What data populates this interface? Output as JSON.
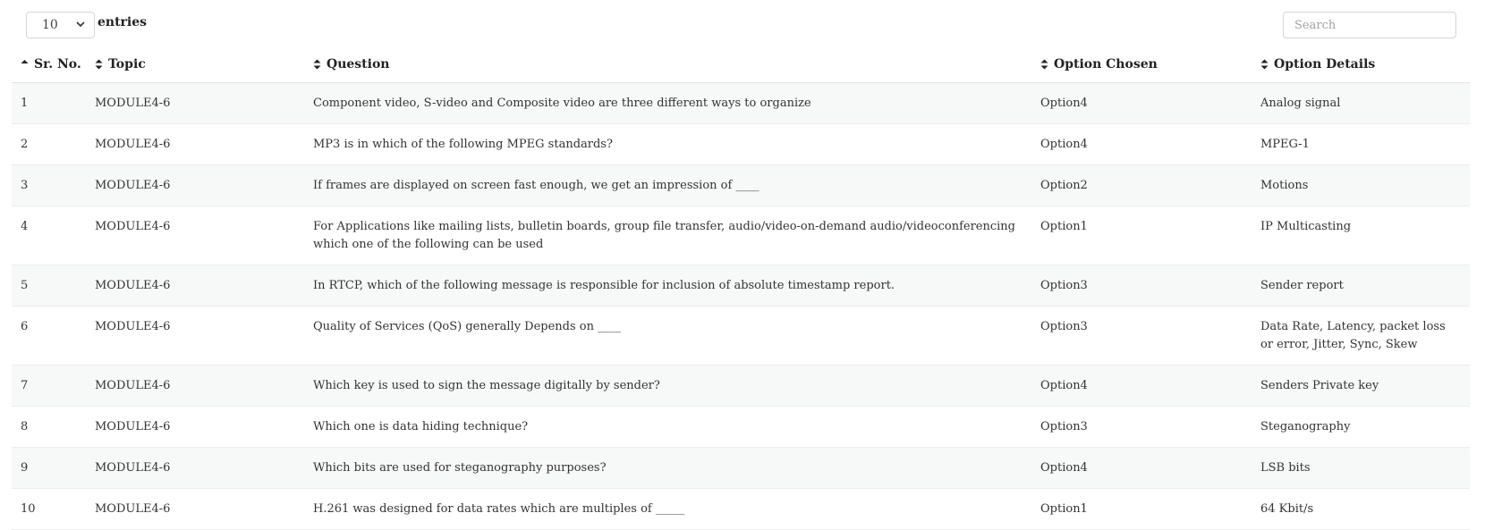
{
  "length_menu": {
    "selected": "10",
    "label": "entries"
  },
  "search": {
    "placeholder": "Search",
    "value": ""
  },
  "table": {
    "columns": [
      "Sr. No.",
      "Topic",
      "Question",
      "Option Chosen",
      "Option Details"
    ],
    "sorted_column": "Sr. No.",
    "sort_direction": "ascending",
    "rows": [
      {
        "sr": "1",
        "topic": "MODULE4-6",
        "question": "Component video, S-video and Composite video are three different ways to organize",
        "chosen": "Option4",
        "details": "Analog signal"
      },
      {
        "sr": "2",
        "topic": "MODULE4-6",
        "question": "MP3 is in which of the following MPEG standards?",
        "chosen": "Option4",
        "details": "MPEG-1"
      },
      {
        "sr": "3",
        "topic": "MODULE4-6",
        "question": "If frames are displayed on screen fast enough, we get an impression of ____",
        "chosen": "Option2",
        "details": "Motions"
      },
      {
        "sr": "4",
        "topic": "MODULE4-6",
        "question": "For Applications like mailing lists, bulletin boards, group file transfer, audio/video-on-demand audio/videoconferencing which one of the following can be used",
        "chosen": "Option1",
        "details": "IP Multicasting"
      },
      {
        "sr": "5",
        "topic": "MODULE4-6",
        "question": "In RTCP, which of the following message is responsible for inclusion of absolute timestamp report.",
        "chosen": "Option3",
        "details": "Sender report"
      },
      {
        "sr": "6",
        "topic": "MODULE4-6",
        "question": "Quality of Services (QoS) generally Depends on ____",
        "chosen": "Option3",
        "details": "Data Rate, Latency, packet loss or error, Jitter, Sync, Skew"
      },
      {
        "sr": "7",
        "topic": "MODULE4-6",
        "question": "Which key is used to sign the message digitally by sender?",
        "chosen": "Option4",
        "details": "Senders Private key"
      },
      {
        "sr": "8",
        "topic": "MODULE4-6",
        "question": "Which one is data hiding technique?",
        "chosen": "Option3",
        "details": "Steganography"
      },
      {
        "sr": "9",
        "topic": "MODULE4-6",
        "question": "Which bits are used for steganography purposes?",
        "chosen": "Option4",
        "details": "LSB bits"
      },
      {
        "sr": "10",
        "topic": "MODULE4-6",
        "question": "H.261 was designed for data rates which are multiples of _____",
        "chosen": "Option1",
        "details": "64 Kbit/s"
      }
    ]
  }
}
